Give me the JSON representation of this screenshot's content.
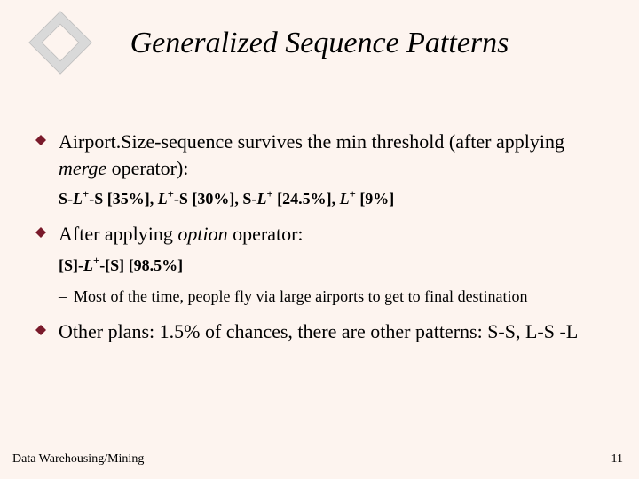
{
  "title": "Generalized Sequence Patterns",
  "bullets": {
    "b1_pre": "Airport.Size-sequence survives the min threshold (after applying ",
    "b1_em": "merge",
    "b1_post": " operator):",
    "b2_pre": "After applying ",
    "b2_em": "option",
    "b2_post": " operator:",
    "b3": "Other plans: 1.5% of chances, there are other patterns: S-S, L-S -L"
  },
  "sub": {
    "s1_a": "S-",
    "s1_b": "L",
    "s1_c": "+",
    "s1_d": "-S",
    "s1_e": " [35%], ",
    "s1_f": "L",
    "s1_g": "+",
    "s1_h": "-S",
    "s1_i": " [30%], ",
    "s1_j": "S-",
    "s1_k": "L",
    "s1_l": "+",
    "s1_m": " [24.5%], ",
    "s1_n": "L",
    "s1_o": "+",
    "s1_p": " [9%]",
    "s2_a": "[S]-",
    "s2_b": "L",
    "s2_c": "+",
    "s2_d": "-[S]",
    "s2_e": " [98.5%]",
    "dash_text": "Most of the time, people fly via large airports to get to final destination"
  },
  "footer": {
    "left": "Data Warehousing/Mining",
    "right": "11"
  }
}
